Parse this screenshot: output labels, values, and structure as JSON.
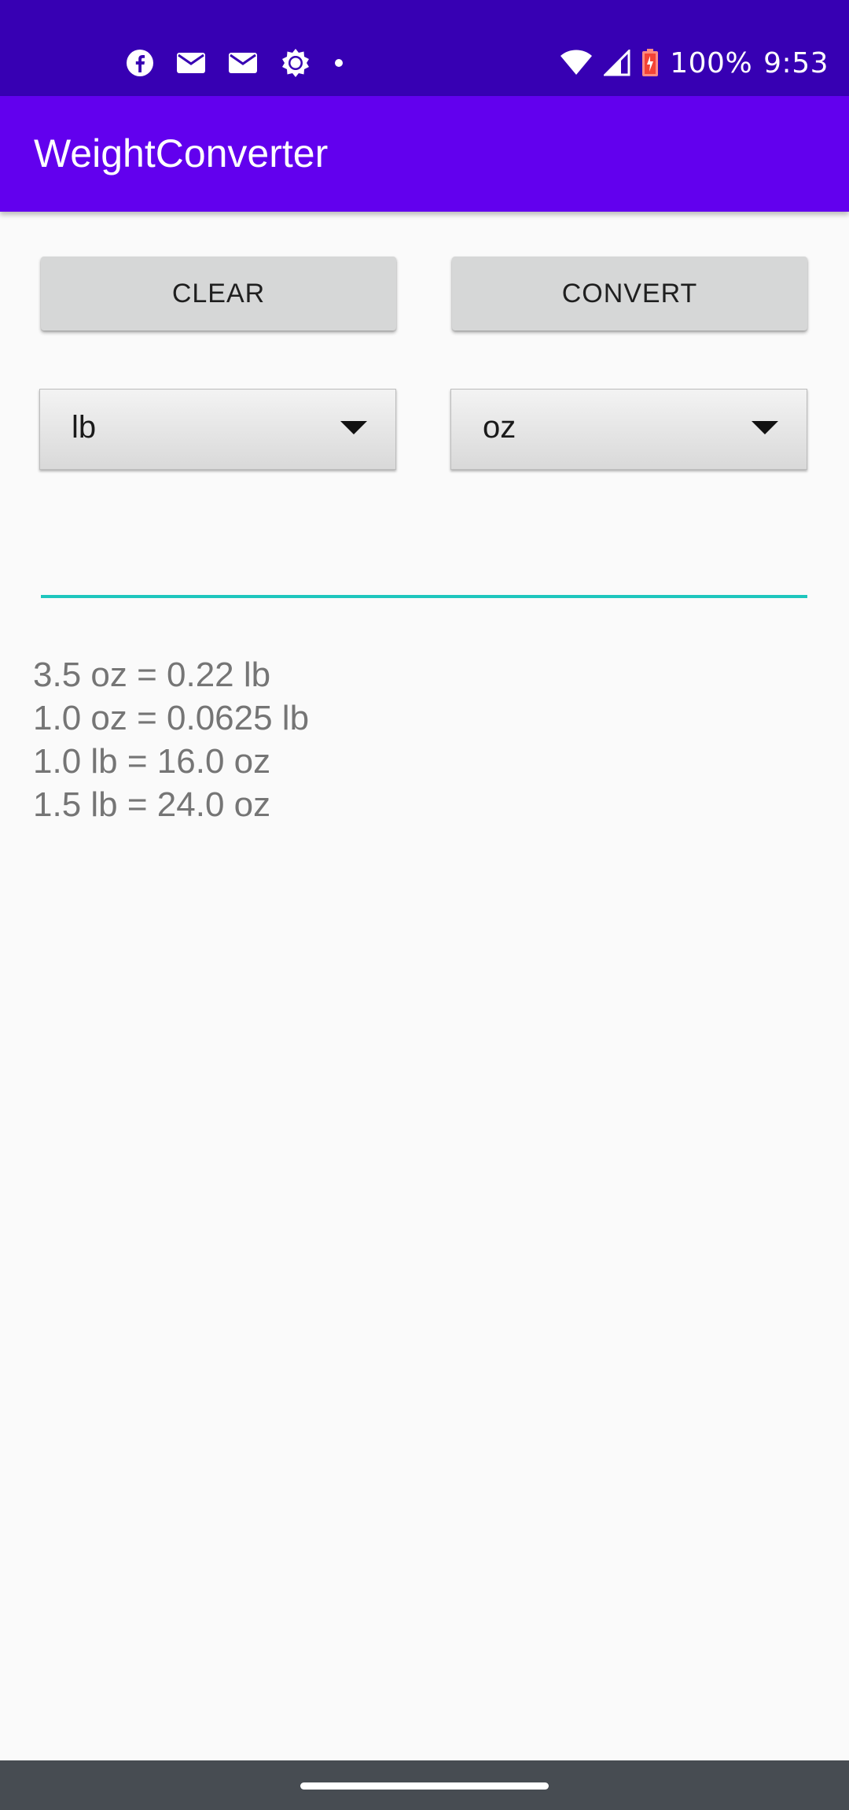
{
  "status_bar": {
    "left_icons": [
      "facebook-icon",
      "gmail-icon",
      "gmail-icon",
      "brightness-icon",
      "dot-icon"
    ],
    "right_icons": [
      "wifi-icon",
      "cellular-signal-icon",
      "battery-charging-icon"
    ],
    "battery_percent": "100%",
    "time": "9:53"
  },
  "app_bar": {
    "title": "WeightConverter",
    "color": "#6200ee"
  },
  "buttons": {
    "clear_label": "CLEAR",
    "convert_label": "CONVERT"
  },
  "spinners": {
    "from_unit": "lb",
    "to_unit": "oz"
  },
  "input": {
    "value": "",
    "underline_color": "#1ec6bd"
  },
  "results": [
    "3.5 oz = 0.22 lb",
    "1.0 oz = 0.0625 lb",
    "1.0 lb = 16.0 oz",
    "1.5 lb = 24.0 oz"
  ]
}
